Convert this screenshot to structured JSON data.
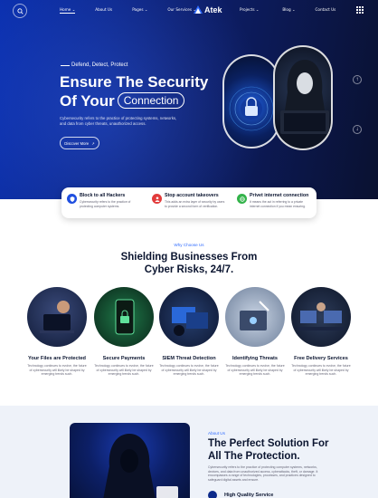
{
  "nav": {
    "links": [
      "Home",
      "About Us",
      "Pages",
      "Our Services",
      "Projects",
      "Blog",
      "Contact Us"
    ],
    "logo": "Atek",
    "accent": "#2f6bff"
  },
  "hero": {
    "kicker": "Defend, Detect, Protect",
    "title_line1": "Ensure The Security",
    "title_line2": "Of Your",
    "title_pill": "Connection",
    "description": "Cybersecurity refers to the practice of protecting systems, networks, and data from cyber threats, unauthorized access.",
    "cta": "Discover More",
    "arrow_up": "↑",
    "arrow_down": "↓"
  },
  "features": [
    {
      "title": "Block to all Hackers",
      "desc": "Cybersecurity refers to the practice of protecting computer systems.",
      "color": "#1f4fe0",
      "icon": "shield-icon"
    },
    {
      "title": "Stop account takeovers",
      "desc": "This adds an extra layer of security by users to provide a second form of verification.",
      "color": "#e23b3b",
      "icon": "user-lock-icon"
    },
    {
      "title": "Privet internet connection",
      "desc": "It means the act in referring to a private internet connection if you mean ensuring.",
      "color": "#33b34a",
      "icon": "globe-icon"
    }
  ],
  "services": {
    "eyebrow": "Why Choose Us",
    "title_line1": "Shielding Businesses From",
    "title_line2": "Cyber Risks, 24/7.",
    "items": [
      {
        "title": "Your Files are Protected",
        "desc": "Technology continues to evolve, the future of cybersecurity will likely be shaped by emerging trends such."
      },
      {
        "title": "Secure Payments",
        "desc": "Technology continues to evolve, the future of cybersecurity will likely be shaped by emerging trends such."
      },
      {
        "title": "SIEM Threat Detection",
        "desc": "Technology continues to evolve, the future of cybersecurity will likely be shaped by emerging trends such."
      },
      {
        "title": "Identifying Threats",
        "desc": "Technology continues to evolve, the future of cybersecurity will likely be shaped by emerging trends such."
      },
      {
        "title": "Free Delivery Services",
        "desc": "Technology continues to evolve, the future of cybersecurity will likely be shaped by emerging trends such."
      }
    ]
  },
  "about": {
    "eyebrow": "About Us",
    "title_line1": "The Perfect Solution For",
    "title_line2": "All The Protection.",
    "description": "Cybersecurity refers to the practice of protecting computer systems, networks, devices, and data from unauthorized access, cyberattacks, theft, or damage. It encompasses a range of technologies, processes, and practices designed to safeguard digital assets and ensure.",
    "feature": "High Quality Service"
  }
}
